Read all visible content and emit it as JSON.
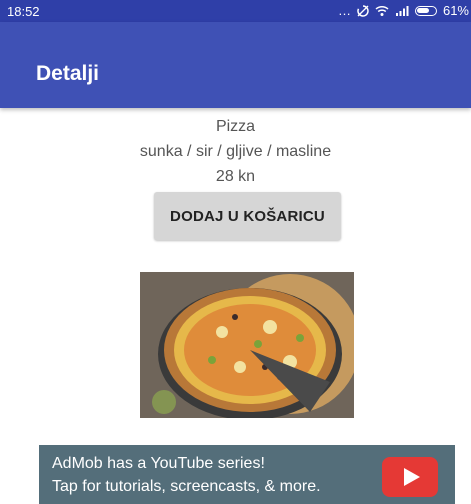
{
  "status_bar": {
    "time": "18:52",
    "signal_dots": "…",
    "battery_percent": "61%"
  },
  "app_bar": {
    "title": "Detalji"
  },
  "product": {
    "name": "Pizza",
    "ingredients": "sunka / sir / gljive / masline",
    "price": "28 kn",
    "add_button_label": "DODAJ U KOŠARICU"
  },
  "ad": {
    "line1": "AdMob has a YouTube series!",
    "line2": "Tap for tutorials, screencasts, & more."
  },
  "colors": {
    "status_bar": "#2f3fa8",
    "app_bar": "#3f51b5",
    "ad_background": "#546e7a",
    "youtube_red": "#e53935"
  }
}
